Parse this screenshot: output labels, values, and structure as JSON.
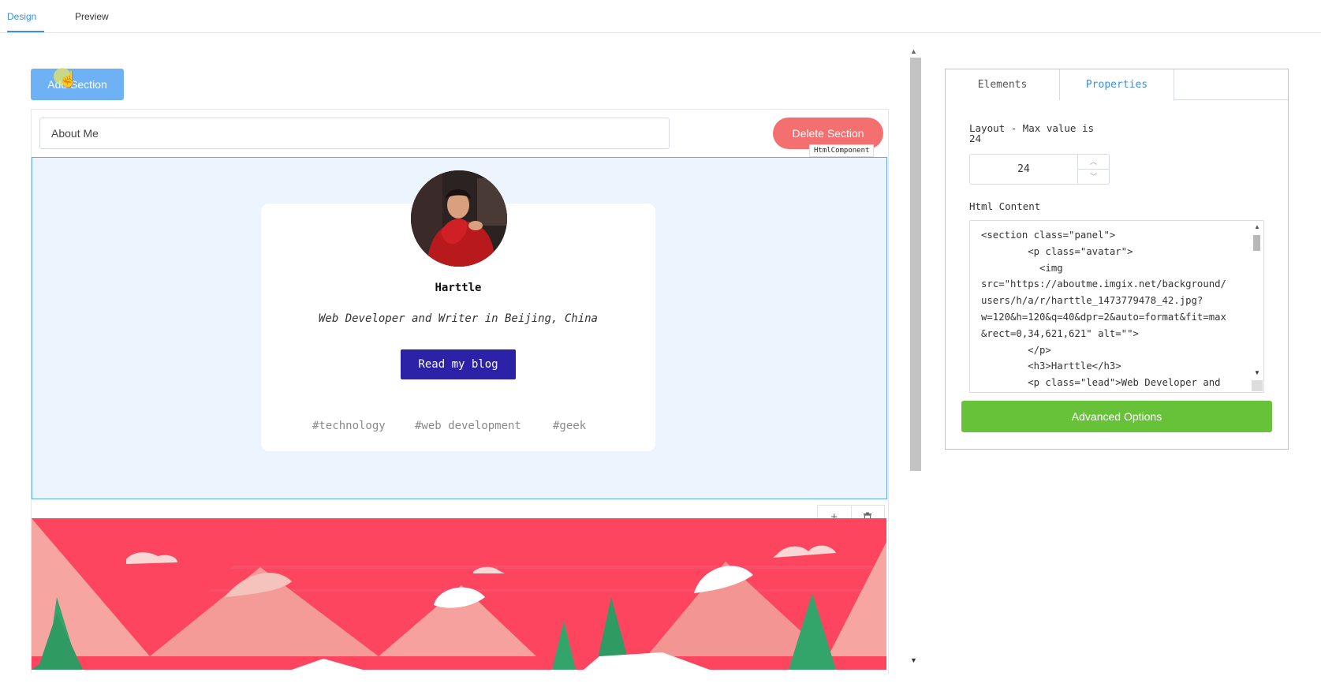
{
  "top_tabs": {
    "design": "Design",
    "preview": "Preview",
    "active": "Design"
  },
  "toolbar": {
    "add_section_label": "Add Section"
  },
  "section": {
    "name_value": "About Me",
    "delete_label": "Delete Section",
    "component_tag": "HtmlComponent"
  },
  "profile": {
    "name": "Harttle",
    "lead": "Web Developer and Writer in Beijing, China",
    "button_label": "Read my blog",
    "tags": [
      "#technology",
      "#web development",
      "#geek"
    ]
  },
  "component_tools": {
    "add_icon": "+",
    "delete_icon": "trash-icon"
  },
  "panel": {
    "tabs": {
      "elements": "Elements",
      "properties": "Properties",
      "active": "Properties"
    },
    "layout_label": "Layout - Max value is\n24",
    "layout_value": "24",
    "html_label": "Html Content",
    "html_content": "<section class=\"panel\">\n        <p class=\"avatar\">\n          <img\nsrc=\"https://aboutme.imgix.net/background/\nusers/h/a/r/harttle_1473779478_42.jpg?\nw=120&h=120&q=40&dpr=2&auto=format&fit=max\n&rect=0,34,621,621\" alt=\"\">\n        </p>\n        <h3>Harttle</h3>\n        <p class=\"lead\">Web Developer and",
    "advanced_label": "Advanced Options"
  },
  "colors": {
    "accent": "#3c8fe0",
    "add_button": "#6fb1f5",
    "delete_button": "#f46f6f",
    "blog_button": "#2c22a8",
    "advanced_button": "#67c23a",
    "component_bg": "#ecf5fe",
    "banner_sky": "#fd4560"
  }
}
